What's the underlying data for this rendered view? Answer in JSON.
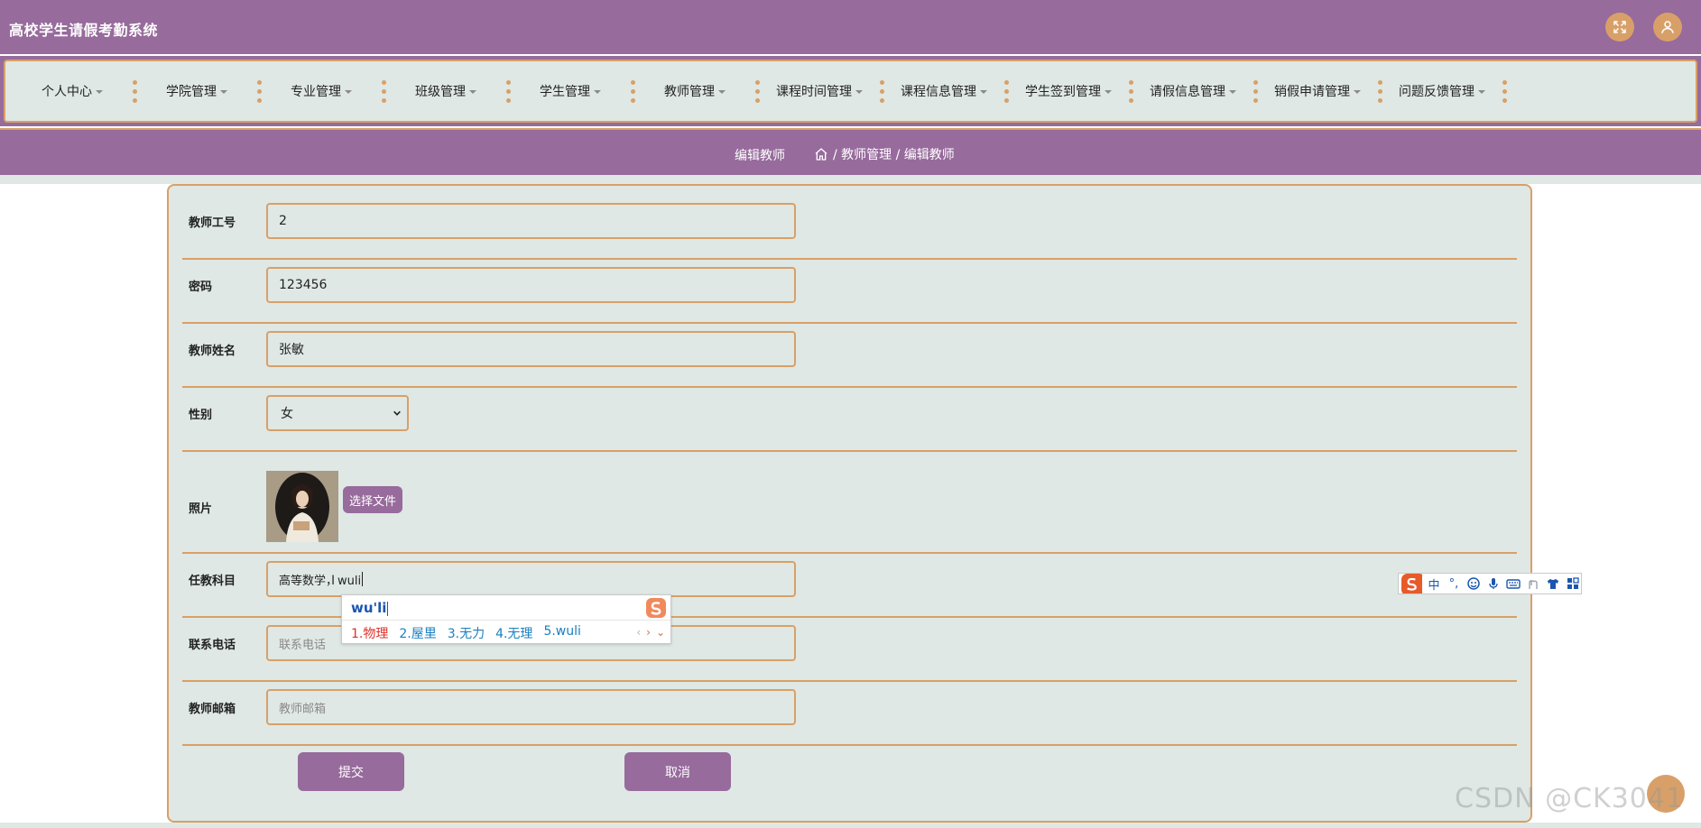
{
  "app": {
    "title": "高校学生请假考勤系统"
  },
  "header_icons": {
    "fullscreen": "fullscreen-icon",
    "user": "user-icon"
  },
  "nav": {
    "items": [
      {
        "label": "个人中心"
      },
      {
        "label": "学院管理"
      },
      {
        "label": "专业管理"
      },
      {
        "label": "班级管理"
      },
      {
        "label": "学生管理"
      },
      {
        "label": "教师管理"
      },
      {
        "label": "课程时间管理"
      },
      {
        "label": "课程信息管理"
      },
      {
        "label": "学生签到管理"
      },
      {
        "label": "请假信息管理"
      },
      {
        "label": "销假申请管理"
      },
      {
        "label": "问题反馈管理"
      }
    ]
  },
  "breadcrumb": {
    "page_title": "编辑教师",
    "path": "/ 教师管理 / 编辑教师"
  },
  "form": {
    "teacher_id": {
      "label": "教师工号",
      "value": "2"
    },
    "password": {
      "label": "密码",
      "value": "123456"
    },
    "teacher_name": {
      "label": "教师姓名",
      "value": "张敏"
    },
    "gender": {
      "label": "性别",
      "value": "女"
    },
    "photo": {
      "label": "照片",
      "button": "选择文件"
    },
    "subject": {
      "label": "任教科目",
      "value": "高等数学，wuli"
    },
    "phone": {
      "label": "联系电话",
      "placeholder": "联系电话"
    },
    "email": {
      "label": "教师邮箱",
      "placeholder": "教师邮箱"
    },
    "submit": "提交",
    "cancel": "取消"
  },
  "ime": {
    "composition": "wu'li",
    "candidates": [
      "1.物理",
      "2.屋里",
      "3.无力",
      "4.无理",
      "5.wuli"
    ],
    "toolbar_mode": "中",
    "toolbar_punct": "°,"
  },
  "watermark": "CSDN @CK3041",
  "colors": {
    "header_bg": "#976b9c",
    "accent": "#d8a068",
    "panel_bg": "#dfe8e4",
    "button_bg": "#976b9c"
  }
}
